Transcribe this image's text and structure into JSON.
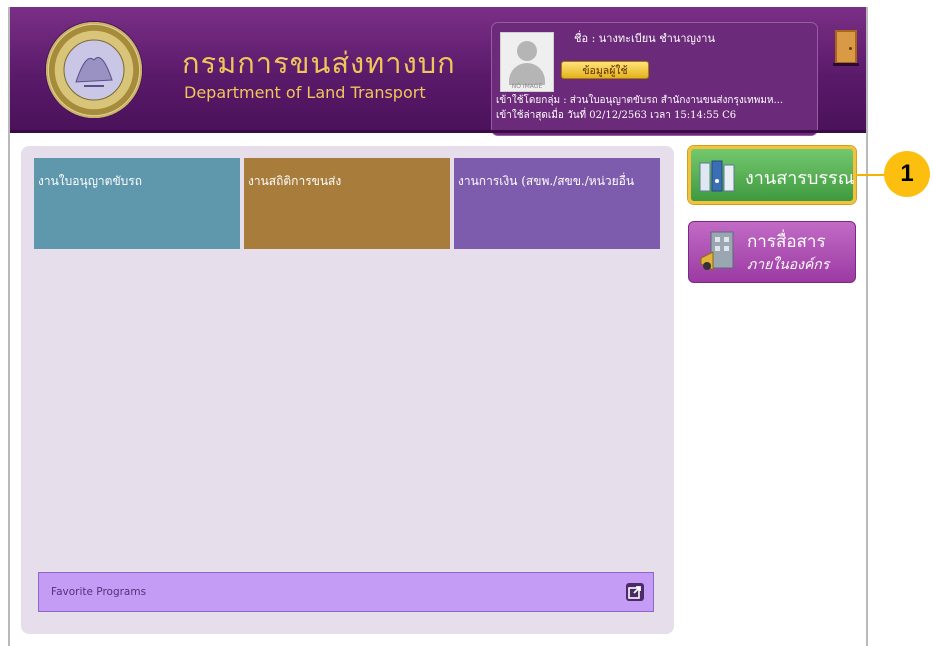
{
  "header": {
    "brand_th": "กรมการขนส่งทางบก",
    "brand_en": "Department of Land Transport"
  },
  "user": {
    "name_line": "ชื่อ :  นางทะเบียน ชำนาญงาน",
    "info_button": "ข้อมูลผู้ใช้",
    "avatar_caption": "NO IMAGE",
    "login_group": "เข้าใช้โดยกลุ่ม : ส่วนใบอนุญาตขับรถ สำนักงานขนส่งกรุงเทพมห...",
    "last_login": "เข้าใช้ล่าสุดเมื่อ วันที่ 02/12/2563 เวลา 15:14:55 C6"
  },
  "tiles": [
    {
      "label": "งานใบอนุญาตขับรถ",
      "color": "#5f97ad"
    },
    {
      "label": "งานสถิติการขนส่ง",
      "color": "#a87d3c"
    },
    {
      "label": "งานการเงิน (สขพ./สขข./หน่วยอื่น",
      "color": "#7e5cad"
    }
  ],
  "favorites": {
    "label": "Favorite Programs"
  },
  "side_buttons": {
    "saraban": {
      "label": "งานสารบรรณ",
      "icon": "document-binders-icon"
    },
    "comm": {
      "label_1": "การสื่อสาร",
      "label_2": "ภายในองค์กร",
      "icon": "building-megaphone-icon"
    }
  },
  "callout": {
    "number": "1",
    "color": "#fdbf0f"
  },
  "colors": {
    "header": "#5a1a6a",
    "accent": "#f0c65a",
    "panel": "#e7deec"
  }
}
